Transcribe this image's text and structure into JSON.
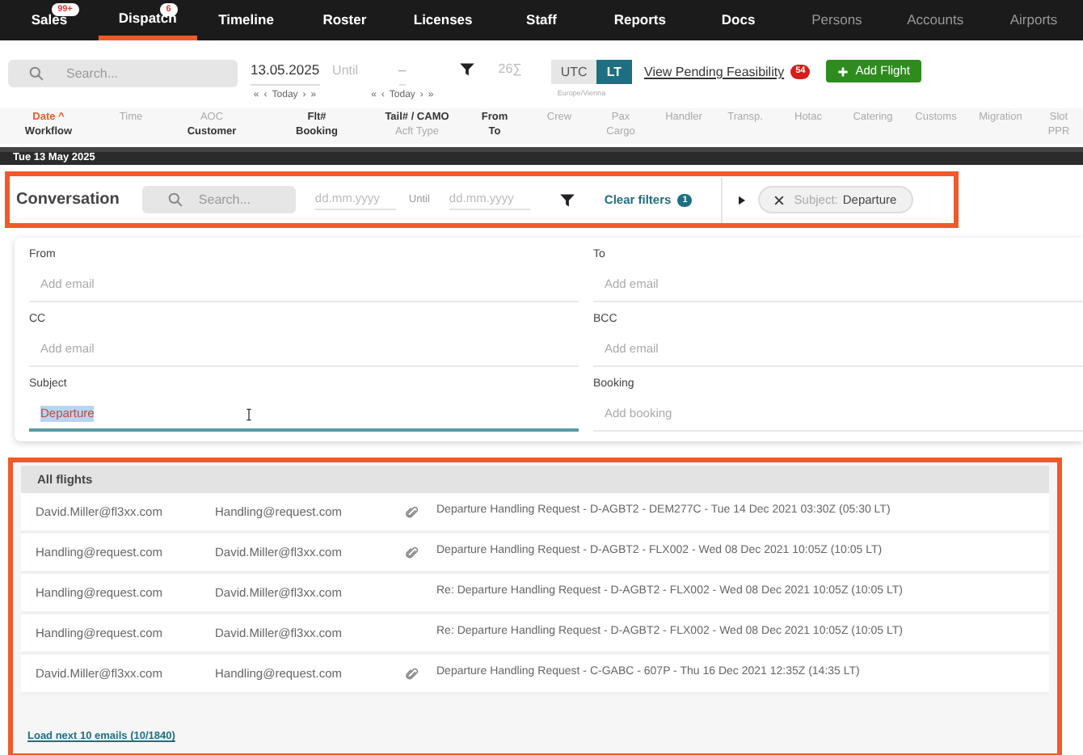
{
  "nav": [
    {
      "label": "Sales",
      "badge": "99+",
      "selected": false,
      "dimmed": false
    },
    {
      "label": "Dispatch",
      "badge": "6",
      "selected": true,
      "dimmed": false
    },
    {
      "label": "Timeline",
      "selected": false,
      "dimmed": false
    },
    {
      "label": "Roster",
      "selected": false,
      "dimmed": false
    },
    {
      "label": "Licenses",
      "selected": false,
      "dimmed": false
    },
    {
      "label": "Staff",
      "selected": false,
      "dimmed": false
    },
    {
      "label": "Reports",
      "selected": false,
      "dimmed": false
    },
    {
      "label": "Docs",
      "selected": false,
      "dimmed": false
    },
    {
      "label": "Persons",
      "selected": false,
      "dimmed": true
    },
    {
      "label": "Accounts",
      "selected": false,
      "dimmed": true
    },
    {
      "label": "Airports",
      "selected": false,
      "dimmed": true
    }
  ],
  "toolbar": {
    "search": {
      "placeholder": "Search..."
    },
    "date_from": "13.05.2025",
    "until": "Until",
    "date_to": "–",
    "date_from_nav": [
      "«",
      "‹",
      "Today",
      "›",
      "»"
    ],
    "date_to_nav": [
      "«",
      "‹",
      "Today",
      "›",
      "»"
    ],
    "sum": "26∑",
    "timezone": [
      {
        "label": "UTC",
        "selected": false
      },
      {
        "label": "LT",
        "selected": true
      }
    ],
    "timezone_name": "Europe/Vienna",
    "pending_link": "View Pending Feasibility",
    "pending_count": "54",
    "add_button": "Add Flight"
  },
  "columns": [
    {
      "top": "Date ^",
      "top_sorted": true,
      "top_bold": true,
      "bottom": "Workflow",
      "bottom_bold": true
    },
    {
      "top": "Time",
      "top_sorted": false,
      "top_bold": false
    },
    {
      "top": "AOC",
      "top_sorted": false,
      "top_bold": false,
      "bottom": "Customer",
      "bottom_bold": true
    },
    {
      "top": "Flt#",
      "top_sorted": false,
      "top_bold": true,
      "bottom": "Booking",
      "bottom_bold": true
    },
    {
      "top": "Tail# / CAMO",
      "top_sorted": false,
      "top_bold": true,
      "bottom": "Acft Type",
      "bottom_bold": false
    },
    {
      "top": "From",
      "top_sorted": false,
      "top_bold": true,
      "bottom": "To",
      "bottom_bold": true
    },
    {
      "top": "Crew",
      "top_sorted": false,
      "top_bold": false
    },
    {
      "top": "Pax",
      "top_sorted": false,
      "top_bold": false,
      "bottom": "Cargo",
      "bottom_bold": false
    },
    {
      "top": "Handler",
      "top_sorted": false,
      "top_bold": false
    },
    {
      "top": "Transp.",
      "top_sorted": false,
      "top_bold": false
    },
    {
      "top": "Hotac",
      "top_sorted": false,
      "top_bold": false
    },
    {
      "top": "Catering",
      "top_sorted": false,
      "top_bold": false
    },
    {
      "top": "Customs",
      "top_sorted": false,
      "top_bold": false
    },
    {
      "top": "Migration",
      "top_sorted": false,
      "top_bold": false
    },
    {
      "top": "Slot",
      "top_sorted": false,
      "top_bold": false,
      "bottom": "PPR",
      "bottom_bold": false
    }
  ],
  "day_header": "Tue 13 May 2025",
  "conversation": {
    "title": "Conversation",
    "search": {
      "placeholder": "Search..."
    },
    "date_from": {
      "placeholder": "dd.mm.yyyy"
    },
    "until": "Until",
    "date_to": {
      "placeholder": "dd.mm.yyyy"
    },
    "clear_filters": "Clear filters",
    "filter_count": "1",
    "chip_label": "Subject:",
    "chip_value": "Departure"
  },
  "form": [
    {
      "label": "From",
      "placeholder": "Add email"
    },
    {
      "label": "To",
      "placeholder": "Add email"
    },
    {
      "label": "CC",
      "placeholder": "Add email"
    },
    {
      "label": "BCC",
      "placeholder": "Add email"
    },
    {
      "label": "Subject",
      "value": "Departure",
      "focused": true
    },
    {
      "label": "Booking",
      "placeholder": "Add booking"
    }
  ],
  "emails": {
    "group": "All flights",
    "rows": [
      {
        "from": "David.Miller@fl3xx.com",
        "to": "Handling@request.com",
        "attachment": true,
        "subject": "Departure Handling Request - D-AGBT2 - DEM277C - Tue 14 Dec 2021 03:30Z (05:30 LT)"
      },
      {
        "from": "Handling@request.com",
        "to": "David.Miller@fl3xx.com",
        "attachment": true,
        "subject": "Departure Handling Request - D-AGBT2 - FLX002 - Wed 08 Dec 2021 10:05Z (10:05 LT)"
      },
      {
        "from": "Handling@request.com",
        "to": "David.Miller@fl3xx.com",
        "attachment": false,
        "subject": "Re: Departure Handling Request - D-AGBT2 - FLX002 - Wed 08 Dec 2021 10:05Z (10:05 LT)"
      },
      {
        "from": "Handling@request.com",
        "to": "David.Miller@fl3xx.com",
        "attachment": false,
        "subject": "Re: Departure Handling Request - D-AGBT2 - FLX002 - Wed 08 Dec 2021 10:05Z (10:05 LT)"
      },
      {
        "from": "David.Miller@fl3xx.com",
        "to": "Handling@request.com",
        "attachment": true,
        "subject": "Departure Handling Request - C-GABC - 607P - Thu 16 Dec 2021 12:35Z (14:35 LT)"
      }
    ],
    "load_more": "Load next 10 emails (10/1840)"
  }
}
